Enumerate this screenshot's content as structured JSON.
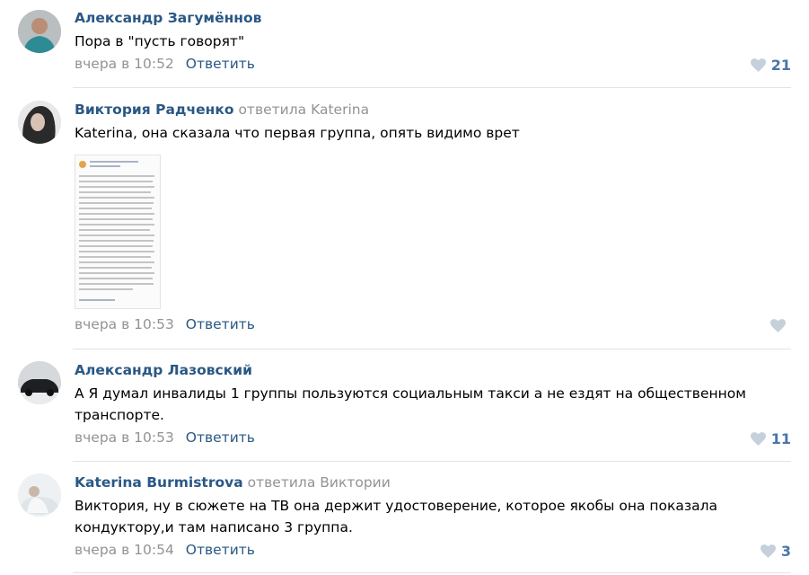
{
  "comments": [
    {
      "author": "Александр Загумённов",
      "replied_to": "",
      "text": "Пора в \"пусть говорят\"",
      "time": "вчера в 10:52",
      "reply_label": "Ответить",
      "likes": "21"
    },
    {
      "author": "Виктория Радченко",
      "replied_to": "ответила Katerina",
      "text": "Katerina, она сказала что первая группа, опять видимо врет",
      "time": "вчера в 10:53",
      "reply_label": "Ответить",
      "likes": ""
    },
    {
      "author": "Александр Лазовский",
      "replied_to": "",
      "text": "А Я думал инвалиды 1 группы пользуются социальным такси а не ездят на общественном транспорте.",
      "time": "вчера в 10:53",
      "reply_label": "Ответить",
      "likes": "11"
    },
    {
      "author": "Katerina Burmistrova",
      "replied_to": "ответила Виктории",
      "text": "Виктория, ну в сюжете на ТВ она держит удостоверение, которое якобы она показала кондуктору,и там написано 3 группа.",
      "time": "вчера в 10:54",
      "reply_label": "Ответить",
      "likes": "3"
    }
  ],
  "colors": {
    "author": "#2a5885",
    "muted": "#939393",
    "like": "#4a76a8",
    "like_inactive": "#c5d0db",
    "divider": "#e1e3e6"
  },
  "icons": {
    "like": "heart-icon"
  }
}
